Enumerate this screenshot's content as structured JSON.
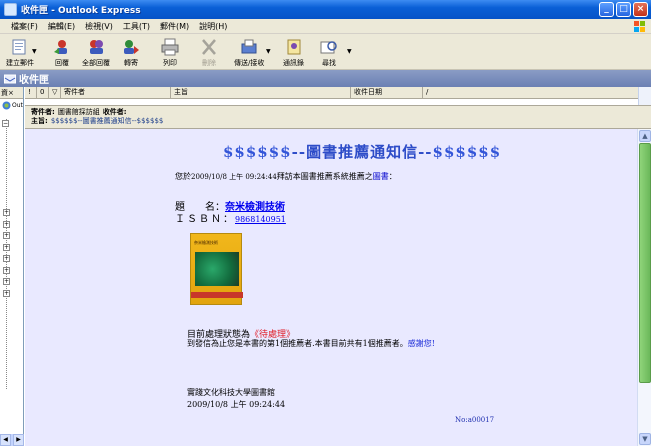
{
  "window": {
    "title": "收件匣 - Outlook Express"
  },
  "menu": [
    "檔案(F)",
    "編輯(E)",
    "檢視(V)",
    "工具(T)",
    "郵件(M)",
    "說明(H)"
  ],
  "toolbar": [
    {
      "label": "建立郵件",
      "icon": "new-mail-icon",
      "dropdown": true
    },
    {
      "label": "回覆",
      "icon": "reply-icon"
    },
    {
      "label": "全部回覆",
      "icon": "reply-all-icon"
    },
    {
      "label": "轉寄",
      "icon": "forward-icon"
    },
    {
      "label": "列印",
      "icon": "print-icon"
    },
    {
      "label": "刪除",
      "icon": "delete-icon",
      "disabled": true
    },
    {
      "label": "傳送/接收",
      "icon": "send-receive-icon",
      "dropdown": true
    },
    {
      "label": "通訊錄",
      "icon": "address-book-icon"
    },
    {
      "label": "尋找",
      "icon": "find-icon",
      "dropdown": true
    }
  ],
  "folder": {
    "name": "收件匣"
  },
  "leftpane": {
    "header": "資",
    "close": "×",
    "root": "Out"
  },
  "columns": {
    "priority": "!",
    "attach": "0",
    "flag": "▽",
    "from": "寄件者",
    "subject": "主旨",
    "received": "收件日期",
    "sort": "/"
  },
  "preview_header": {
    "from_label": "寄件者:",
    "from_value": "圖書館採訪組",
    "to_label": "收件者:",
    "to_value": "",
    "subject_label": "主旨:",
    "subject_value": "$$$$$$--圖書推薦通知信--$$$$$$"
  },
  "mail": {
    "title_left": "$$$$$$",
    "title_mid": "--圖書推薦通知信--",
    "title_right": "$$$$$$",
    "intro_prefix": "您於",
    "intro_timestamp": "2009/10/8 上午 09:24:44",
    "intro_suffix": "拜訪本圖書推薦系統推薦之",
    "intro_link": "圖書",
    "intro_end": "：",
    "book_label": "題　　名：",
    "book_title": "奈米檢測技術",
    "isbn_label": "ＩＳＢＮ：",
    "isbn": "9868140951",
    "cover_text": "奈米檢測技術",
    "status_prefix": "目前處理狀態為",
    "status_value": "《待處理》",
    "count_text": "到發信為止您是本書的第1個推薦者.本書目前共有1個推薦者。",
    "thanks": "感謝您!",
    "org": "實踐文化科技大學圖書館",
    "sig_date": "2009/10/8 上午 09:24:44",
    "ref_no": "No:a00017"
  },
  "window_buttons": {
    "minimize": "_",
    "maximize": "□",
    "close": "×"
  },
  "colors": {
    "preview_bg": "#e9e9ff",
    "title_blue": "#2d4cc8",
    "pending_red": "#e0202a",
    "scroll_green": "#6bb85a"
  }
}
